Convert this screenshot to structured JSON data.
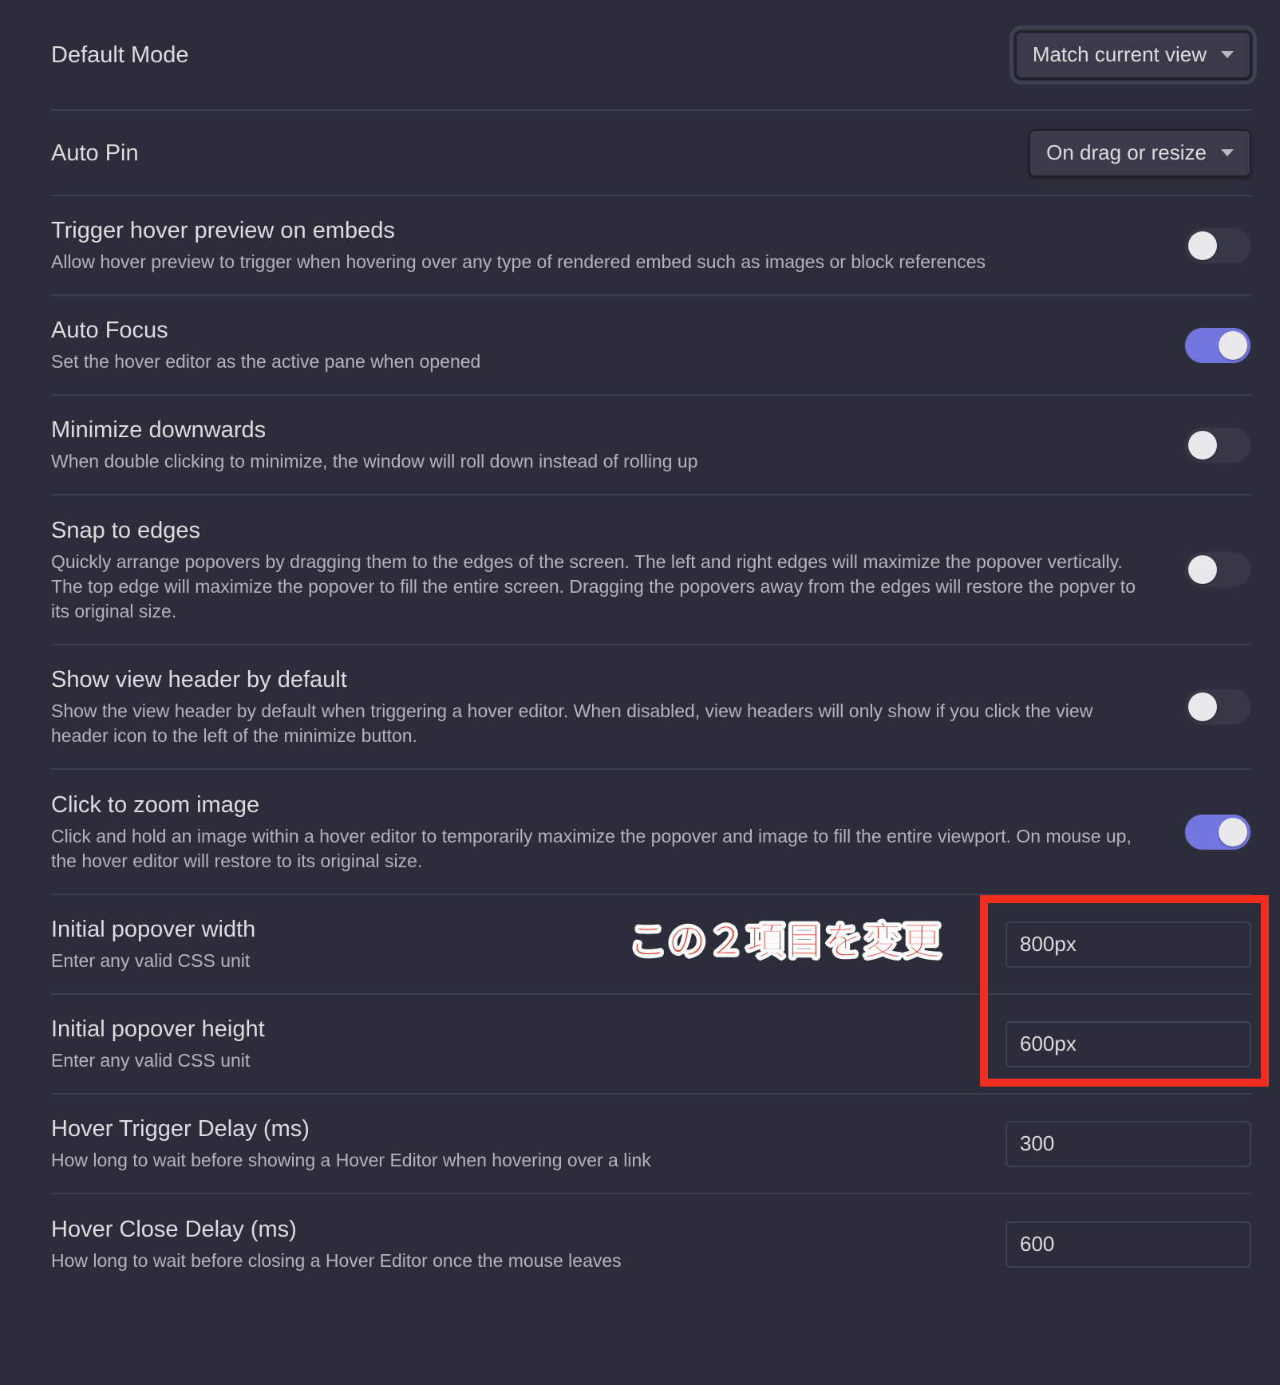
{
  "settings": [
    {
      "id": "default-mode",
      "title": "Default Mode",
      "control": "dropdown",
      "value": "Match current view",
      "focused": true
    },
    {
      "id": "auto-pin",
      "title": "Auto Pin",
      "control": "dropdown",
      "value": "On drag or resize"
    },
    {
      "id": "trigger-hover-embeds",
      "title": "Trigger hover preview on embeds",
      "desc": "Allow hover preview to trigger when hovering over any type of rendered embed such as images or block references",
      "control": "toggle",
      "on": false
    },
    {
      "id": "auto-focus",
      "title": "Auto Focus",
      "desc": "Set the hover editor as the active pane when opened",
      "control": "toggle",
      "on": true
    },
    {
      "id": "minimize-downwards",
      "title": "Minimize downwards",
      "desc": "When double clicking to minimize, the window will roll down instead of rolling up",
      "control": "toggle",
      "on": false
    },
    {
      "id": "snap-to-edges",
      "title": "Snap to edges",
      "desc": "Quickly arrange popovers by dragging them to the edges of the screen. The left and right edges will maximize the popover vertically. The top edge will maximize the popover to fill the entire screen. Dragging the popovers away from the edges will restore the popver to its original size.",
      "control": "toggle",
      "on": false
    },
    {
      "id": "show-view-header",
      "title": "Show view header by default",
      "desc": "Show the view header by default when triggering a hover editor. When disabled, view headers will only show if you click the view header icon to the left of the minimize button.",
      "control": "toggle",
      "on": false
    },
    {
      "id": "click-to-zoom",
      "title": "Click to zoom image",
      "desc": "Click and hold an image within a hover editor to temporarily maximize the popover and image to fill the entire viewport. On mouse up, the hover editor will restore to its original size.",
      "control": "toggle",
      "on": true
    },
    {
      "id": "initial-width",
      "title": "Initial popover width",
      "desc": "Enter any valid CSS unit",
      "control": "text",
      "value": "800px"
    },
    {
      "id": "initial-height",
      "title": "Initial popover height",
      "desc": "Enter any valid CSS unit",
      "control": "text",
      "value": "600px"
    },
    {
      "id": "hover-trigger-delay",
      "title": "Hover Trigger Delay (ms)",
      "desc": "How long to wait before showing a Hover Editor when hovering over a link",
      "control": "text",
      "value": "300"
    },
    {
      "id": "hover-close-delay",
      "title": "Hover Close Delay (ms)",
      "desc": "How long to wait before closing a Hover Editor once the mouse leaves",
      "control": "text",
      "value": "600"
    }
  ],
  "annotation": {
    "text": "この２項目を変更",
    "color": "#f0382b"
  },
  "colors": {
    "background": "#2b2d3a",
    "accent": "#7277e0",
    "divider": "#3c3f4c"
  }
}
